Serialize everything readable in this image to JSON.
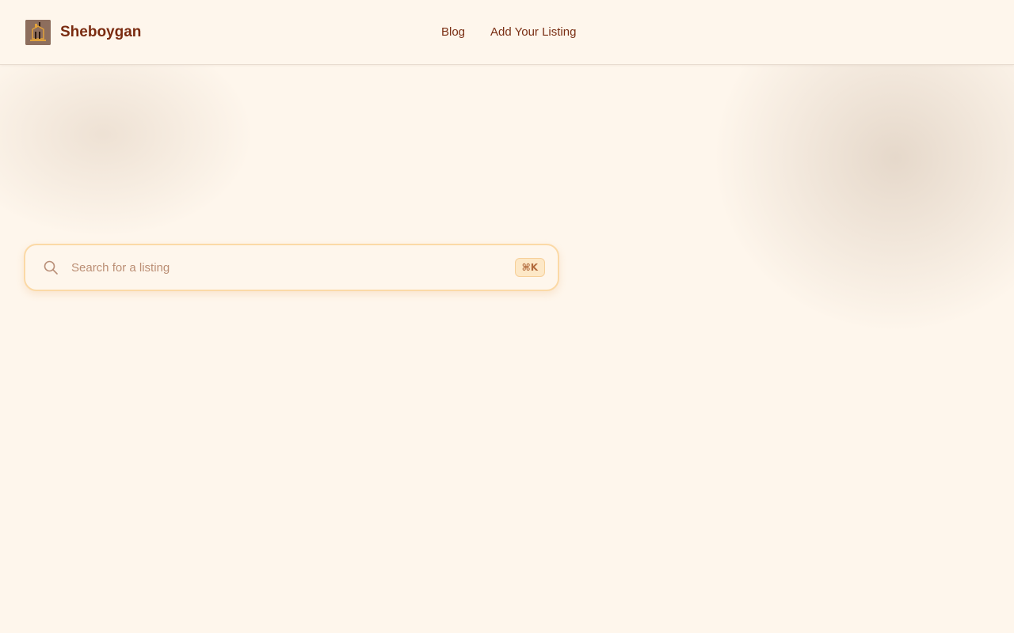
{
  "header": {
    "brand_name": "Sheboygan",
    "logo_icon": "building-logo-icon",
    "nav": [
      {
        "label": "Blog"
      },
      {
        "label": "Add Your Listing"
      }
    ]
  },
  "search": {
    "placeholder": "Search for a listing",
    "value": "",
    "shortcut": "⌘K",
    "icon": "search-icon"
  },
  "colors": {
    "background": "#fef6ec",
    "brand_text": "#7a2b10",
    "nav_text": "#7a2f14",
    "search_border": "#fbd9a6",
    "shortcut_bg": "#fde8c7",
    "placeholder": "#bb8e74"
  }
}
